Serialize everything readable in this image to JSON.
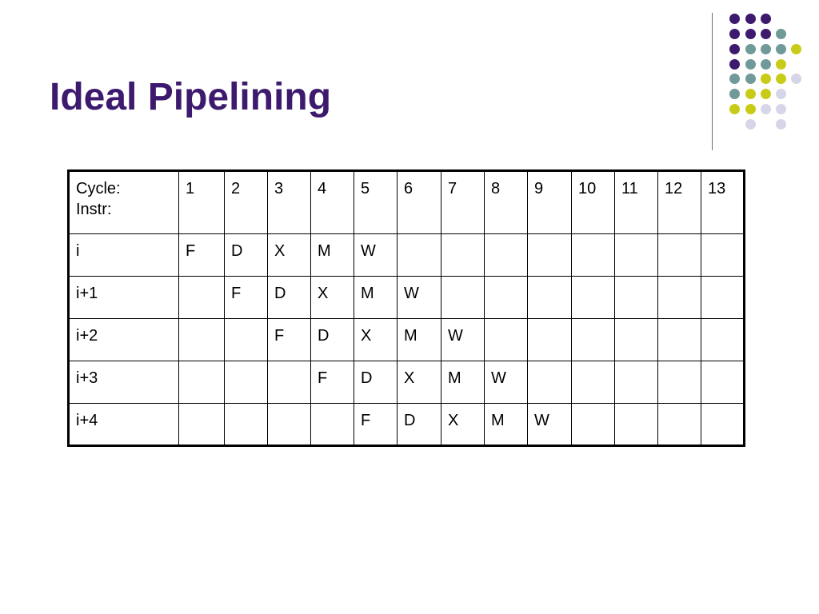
{
  "slide": {
    "title": "Ideal Pipelining",
    "accent_colors": {
      "title": "#3d1a6e",
      "dot_purple": "#3d1a6e",
      "dot_teal": "#6f9a99",
      "dot_yellow": "#c8cc18",
      "dot_lavender": "#d7d5e8"
    }
  },
  "table": {
    "header_label_line1": "Cycle:",
    "header_label_line2": "Instr:",
    "cycles": [
      "1",
      "2",
      "3",
      "4",
      "5",
      "6",
      "7",
      "8",
      "9",
      "10",
      "11",
      "12",
      "13"
    ],
    "rows": [
      {
        "instr": "i",
        "cells": [
          "F",
          "D",
          "X",
          "M",
          "W",
          "",
          "",
          "",
          "",
          "",
          "",
          "",
          ""
        ]
      },
      {
        "instr": "i+1",
        "cells": [
          "",
          "F",
          "D",
          "X",
          "M",
          "W",
          "",
          "",
          "",
          "",
          "",
          "",
          ""
        ]
      },
      {
        "instr": "i+2",
        "cells": [
          "",
          "",
          "F",
          "D",
          "X",
          "M",
          "W",
          "",
          "",
          "",
          "",
          "",
          ""
        ]
      },
      {
        "instr": "i+3",
        "cells": [
          "",
          "",
          "",
          "F",
          "D",
          "X",
          "M",
          "W",
          "",
          "",
          "",
          "",
          ""
        ]
      },
      {
        "instr": "i+4",
        "cells": [
          "",
          "",
          "",
          "",
          "F",
          "D",
          "X",
          "M",
          "W",
          "",
          "",
          "",
          ""
        ]
      }
    ]
  }
}
